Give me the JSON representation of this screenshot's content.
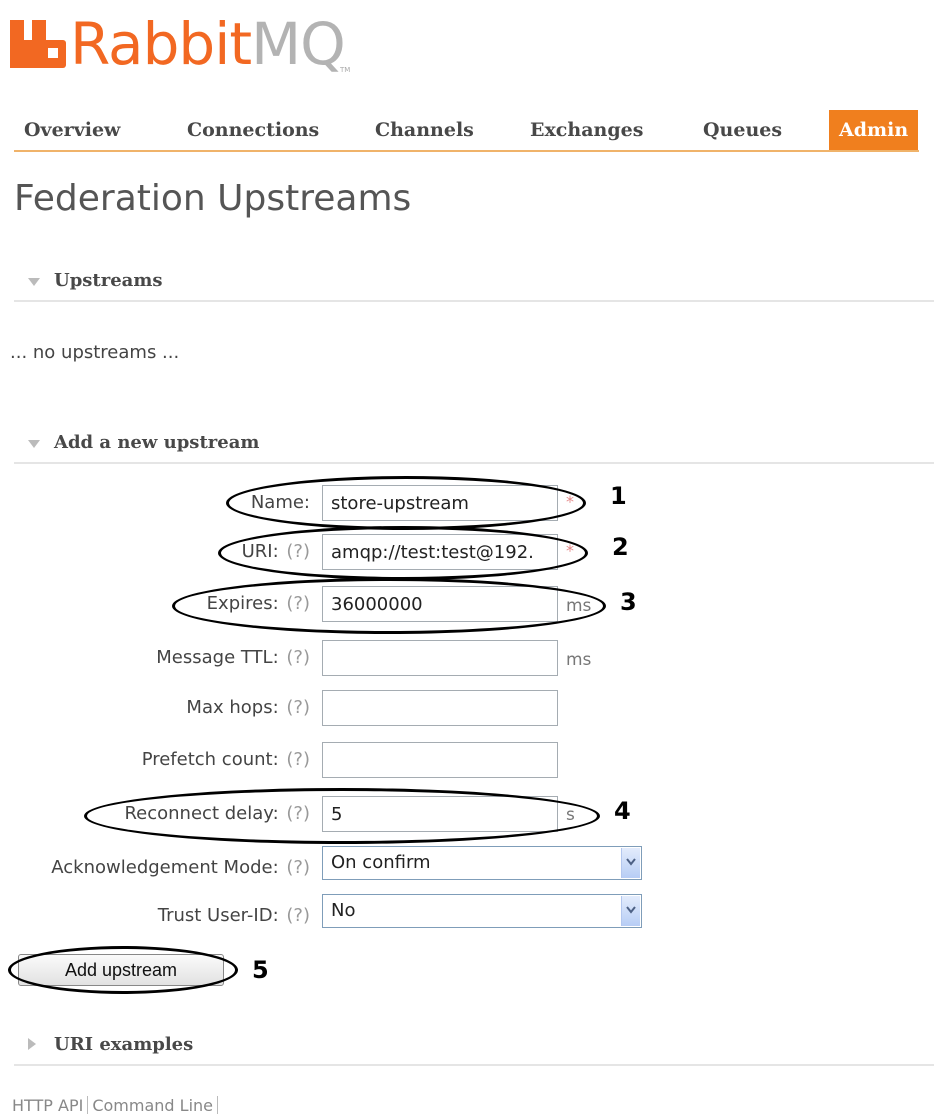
{
  "logo": {
    "brand": "Rabbit",
    "brand_mq": "MQ",
    "tm": "TM"
  },
  "nav": {
    "tabs": [
      {
        "label": "Overview"
      },
      {
        "label": "Connections"
      },
      {
        "label": "Channels"
      },
      {
        "label": "Exchanges"
      },
      {
        "label": "Queues"
      },
      {
        "label": "Admin",
        "active": true
      }
    ]
  },
  "page": {
    "title": "Federation Upstreams"
  },
  "upstreams_section": {
    "header": "Upstreams",
    "empty_message": "... no upstreams ..."
  },
  "add_section": {
    "header": "Add a new upstream"
  },
  "form": {
    "help": "(?)",
    "required": "*",
    "name": {
      "label": "Name:",
      "value": "store-upstream"
    },
    "uri": {
      "label": "URI:",
      "value": "amqp://test:test@192."
    },
    "expires": {
      "label": "Expires:",
      "value": "36000000",
      "unit": "ms"
    },
    "message_ttl": {
      "label": "Message TTL:",
      "value": "",
      "unit": "ms"
    },
    "max_hops": {
      "label": "Max hops:",
      "value": ""
    },
    "prefetch_count": {
      "label": "Prefetch count:",
      "value": ""
    },
    "reconnect_delay": {
      "label": "Reconnect delay:",
      "value": "5",
      "unit": "s"
    },
    "ack_mode": {
      "label": "Acknowledgement Mode:",
      "value": "On confirm"
    },
    "trust_user_id": {
      "label": "Trust User-ID:",
      "value": "No"
    },
    "submit_label": "Add upstream"
  },
  "annotations": [
    "1",
    "2",
    "3",
    "4",
    "5"
  ],
  "uri_examples_section": {
    "header": "URI examples"
  },
  "footer": {
    "links": [
      "HTTP API",
      "Command Line"
    ]
  },
  "colors": {
    "accent": "#f07f1e",
    "brand_orange": "#f26822",
    "brand_grey": "#b3b3b3"
  }
}
